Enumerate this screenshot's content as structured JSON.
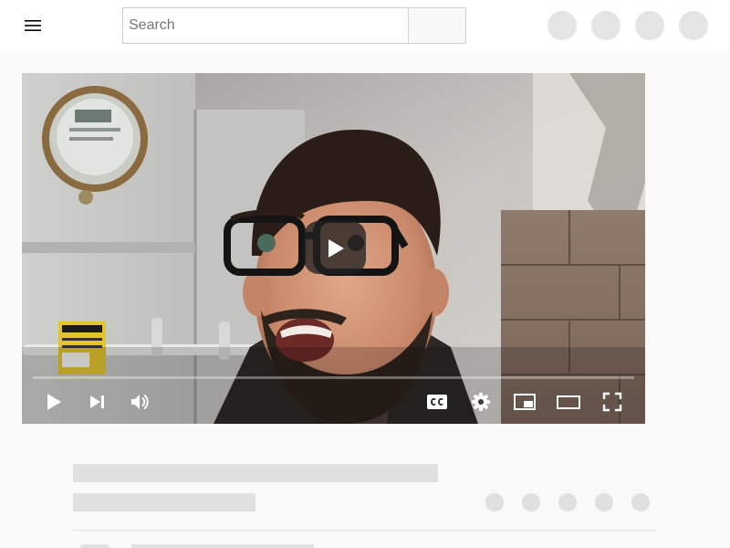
{
  "header": {
    "menu_icon": "hamburger-menu-icon",
    "search": {
      "placeholder": "Search",
      "value": ""
    },
    "search_button_icon": "search-icon",
    "actions": [
      "create-icon",
      "apps-icon",
      "notifications-icon",
      "avatar"
    ]
  },
  "player": {
    "center_control": "play-icon",
    "progress": 0,
    "controls_left": [
      "play-icon",
      "skip-next-icon",
      "volume-icon"
    ],
    "controls_right": [
      "captions-icon",
      "settings-icon",
      "miniplayer-icon",
      "theater-mode-icon",
      "fullscreen-icon"
    ],
    "colors": {
      "accent": "#ff0000",
      "overlay": "#212121"
    }
  },
  "below_video": {
    "state": "loading-placeholder",
    "action_placeholders": 5,
    "placeholder_color": "#e0e0e0"
  }
}
